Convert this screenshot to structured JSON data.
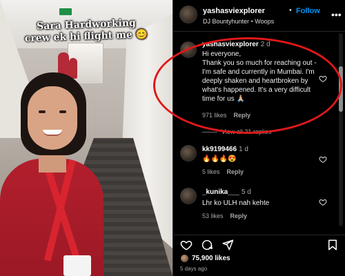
{
  "media": {
    "caption_line1": "Sara Hardworking",
    "caption_line2": "crew ek hi flight me 😊"
  },
  "post": {
    "username": "yashasviexplorer",
    "dot": "•",
    "follow_label": "Follow",
    "audio_artist": "DJ Bountyhunter",
    "audio_sep": "•",
    "audio_title": "Woops",
    "more_icon": "more-horizontal-icon"
  },
  "comments": [
    {
      "username": "yashasviexplorer",
      "age": "2 d",
      "text": "Hi everyone,\nThank you so much for reaching out - I'm safe and currently in Mumbai. I'm deeply shaken and heartbroken by what's happened. It's a very difficult time for us 🙏🏼",
      "likes": "971 likes",
      "reply_label": "Reply",
      "view_replies": "View all 21 replies"
    },
    {
      "username": "kk9199466",
      "age": "1 d",
      "text": "🔥🔥🔥😍",
      "likes": "5 likes",
      "reply_label": "Reply"
    },
    {
      "username": "_kunika___",
      "age": "5 d",
      "text": "Lhr ko ULH nah kehte",
      "likes": "53 likes",
      "reply_label": "Reply"
    }
  ],
  "footer": {
    "likes_count": "75,900 likes",
    "posted_ago": "5 days ago"
  },
  "colors": {
    "accent": "#0095f6",
    "highlight": "#e01818",
    "background": "#000000"
  }
}
